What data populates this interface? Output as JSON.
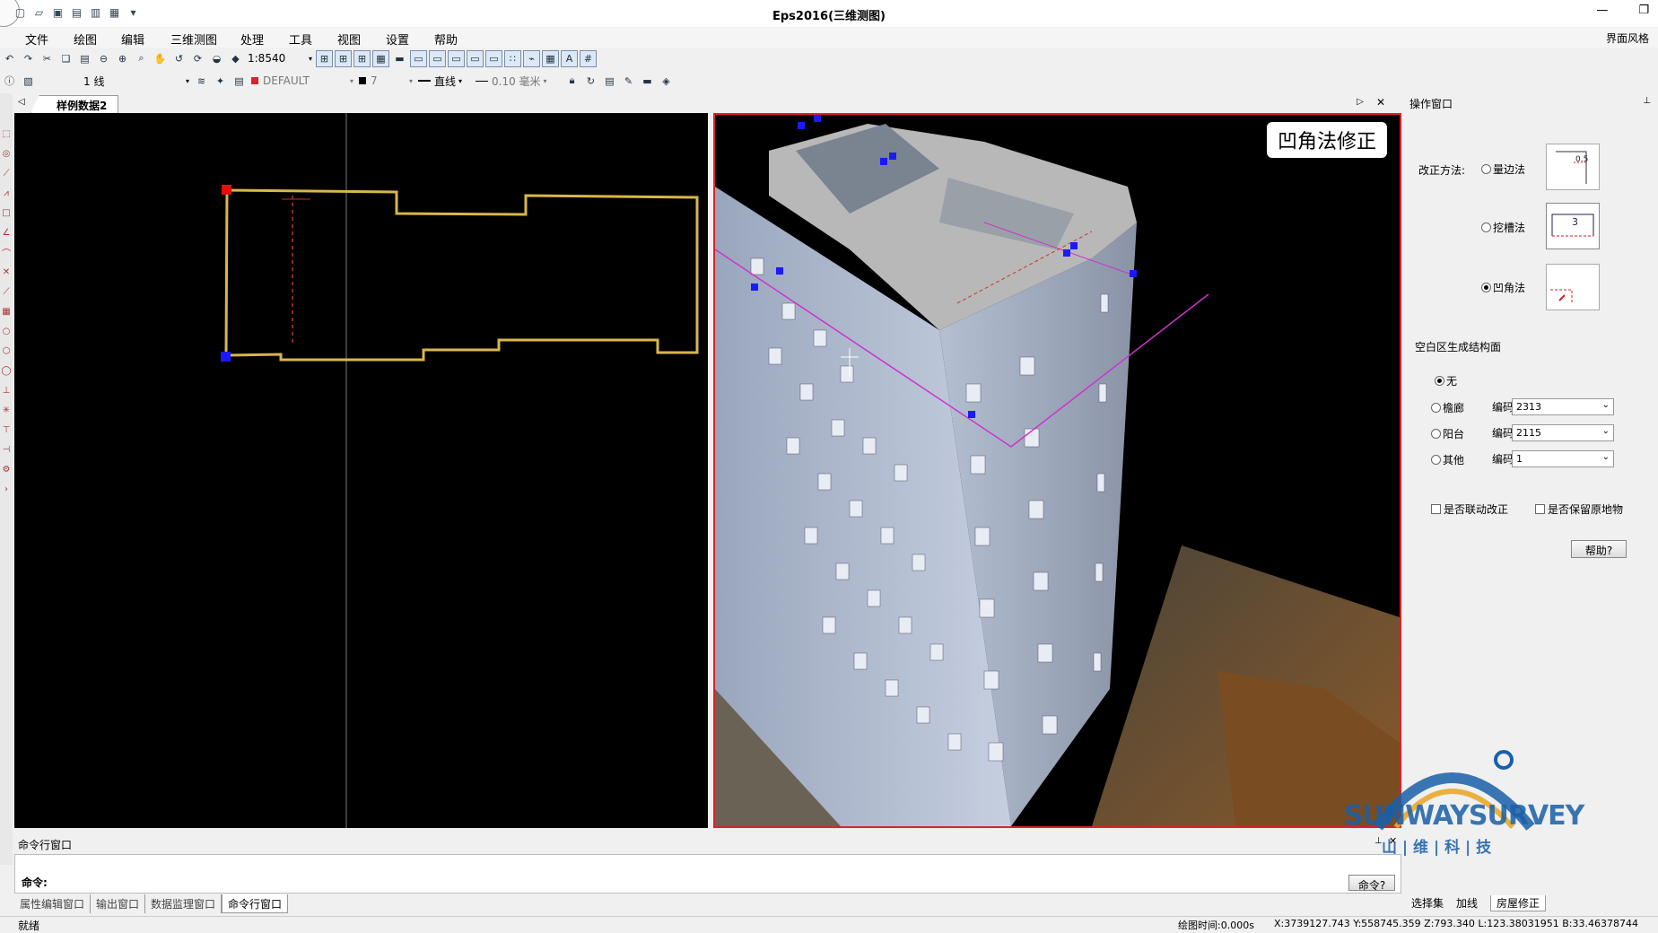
{
  "app": {
    "title": "Eps2016(三维测图)",
    "style_button": "界面风格"
  },
  "menu": [
    "文件",
    "绘图",
    "编辑",
    "三维测图",
    "处理",
    "工具",
    "视图",
    "设置",
    "帮助"
  ],
  "toolbar1": {
    "scale": "1:8540"
  },
  "toolbar2": {
    "layer": "1 线",
    "layer_name": "DEFAULT",
    "color_index": "7",
    "line_type": "直线",
    "line_width": "0.10 毫米"
  },
  "doc_tab": "样例数据2",
  "view_badge": "凹角法修正",
  "op_window": {
    "title": "操作窗口",
    "method_label": "改正方法:",
    "methods": [
      {
        "label": "量边法",
        "checked": false,
        "icon_text": "0.5"
      },
      {
        "label": "挖槽法",
        "checked": false,
        "icon_text": "3"
      },
      {
        "label": "凹角法",
        "checked": true,
        "icon_text": ""
      }
    ],
    "section_label": "空白区生成结构面",
    "struct_options": [
      {
        "label": "无",
        "checked": true
      },
      {
        "label": "檐廊",
        "checked": false,
        "code_label": "编码",
        "code": "2313"
      },
      {
        "label": "阳台",
        "checked": false,
        "code_label": "编码",
        "code": "2115"
      },
      {
        "label": "其他",
        "checked": false,
        "code_label": "编码",
        "code": "1"
      }
    ],
    "chk_linked": "是否联动改正",
    "chk_keep": "是否保留原地物",
    "help_button": "帮助?"
  },
  "command": {
    "title": "命令行窗口",
    "prompt": "命令:",
    "button": "命令?"
  },
  "bottom_tabs": [
    "属性编辑窗口",
    "输出窗口",
    "数据监理窗口",
    "命令行窗口"
  ],
  "right_tabs": [
    "选择集",
    "加线",
    "房屋修正"
  ],
  "status": {
    "text": "就绪",
    "draw_time": "绘图时间:0.000s",
    "coords": "X:3739127.743 Y:558745.359 Z:793.340 L:123.38031951 B:33.46378744"
  },
  "logo": {
    "name": "SUNWAYSURVEY",
    "sub": "山 | 维 | 科 | 技"
  },
  "colors": {
    "accent_red": "#e0202a",
    "outline_yellow": "#d8b64c",
    "marker_blue": "#1a1aff",
    "logo_blue": "#1a5fa8",
    "logo_gold": "#e8a82a"
  }
}
